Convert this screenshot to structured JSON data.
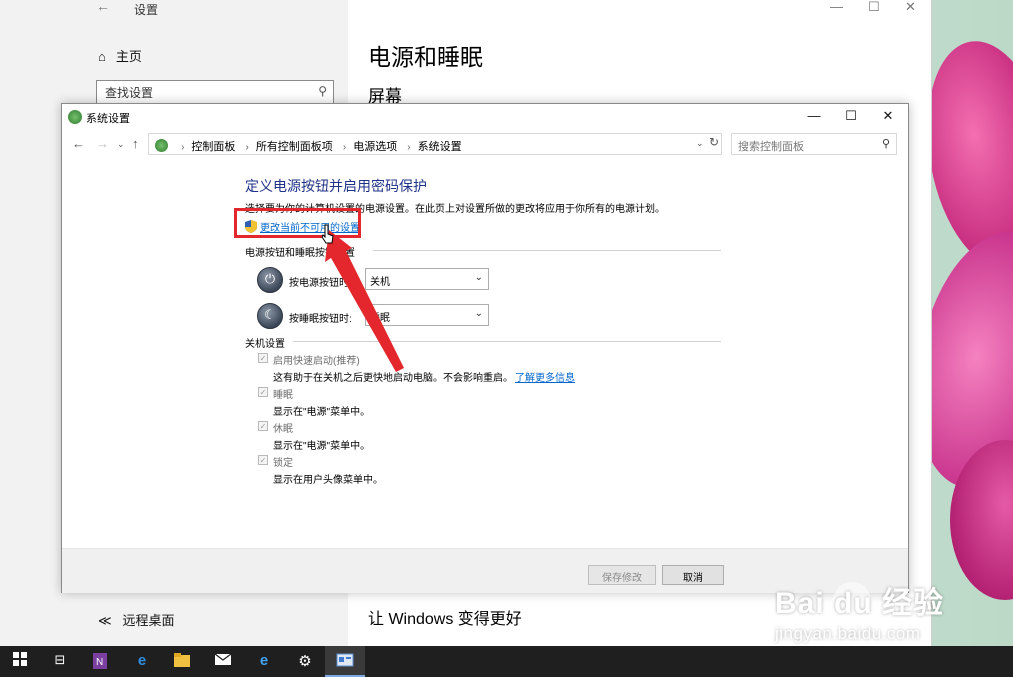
{
  "settings_window": {
    "title": "设置",
    "back_glyph": "←",
    "home_label": "主页",
    "search_placeholder": "查找设置",
    "remote_label": "远程桌面",
    "heading": "电源和睡眠",
    "subheading": "屏幕",
    "bottom_heading": "让 Windows 变得更好"
  },
  "dialog": {
    "title": "系统设置",
    "breadcrumb": [
      "控制面板",
      "所有控制面板项",
      "电源选项",
      "系统设置"
    ],
    "search_placeholder": "搜索控制面板",
    "page_heading": "定义电源按钮并启用密码保护",
    "page_desc": "选择要为你的计算机设置的电源设置。在此页上对设置所做的更改将应用于你所有的电源计划。",
    "change_link": "更改当前不可用的设置",
    "power_group_label": "电源按钮和睡眠按钮设置",
    "power_button_label": "按电源按钮时:",
    "power_button_value": "关机",
    "sleep_button_label": "按睡眠按钮时:",
    "sleep_button_value": "睡眠",
    "shutdown_group_label": "关机设置",
    "shutdown_options": [
      {
        "label": "启用快速启动(推荐)",
        "desc": "这有助于在关机之后更快地启动电脑。不会影响重启。",
        "checked": true
      },
      {
        "label": "睡眠",
        "desc": "显示在\"电源\"菜单中。",
        "checked": true
      },
      {
        "label": "休眠",
        "desc": "显示在\"电源\"菜单中。",
        "checked": true
      },
      {
        "label": "锁定",
        "desc": "显示在用户头像菜单中。",
        "checked": true
      }
    ],
    "learn_more_link": "了解更多信息",
    "save_button": "保存修改",
    "cancel_button": "取消"
  },
  "watermark": {
    "brand": "Bai du 经验",
    "url": "jingyan.baidu.com"
  },
  "taskbar": {
    "items": [
      "start-icon",
      "task-view-icon",
      "onenote-icon",
      "edge-icon",
      "file-explorer-icon",
      "mail-icon",
      "ie-icon",
      "settings-icon",
      "control-panel-icon"
    ]
  },
  "colors": {
    "annotation_red": "#e4262d",
    "link_blue": "#0066cc",
    "heading_blue": "#1e3287"
  }
}
